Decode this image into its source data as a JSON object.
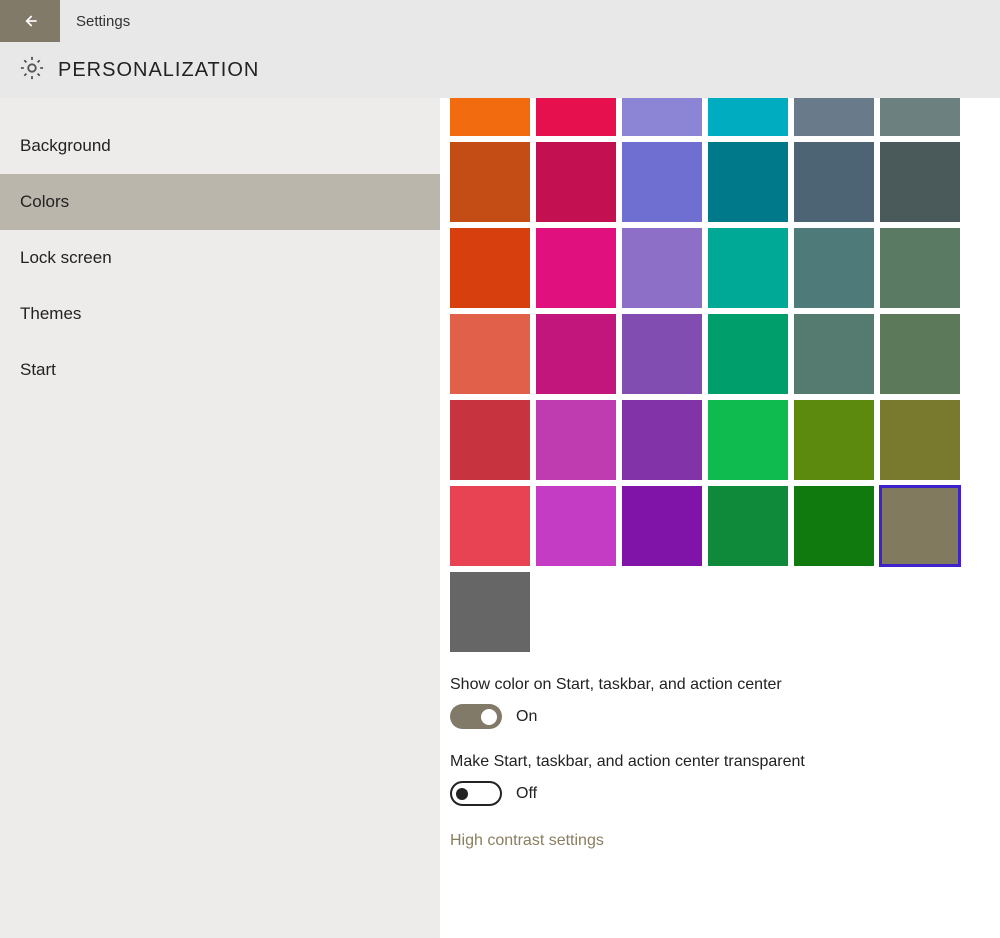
{
  "titlebar": {
    "title": "Settings"
  },
  "header": {
    "title": "PERSONALIZATION"
  },
  "sidebar": {
    "items": [
      {
        "label": "Background",
        "selected": false
      },
      {
        "label": "Colors",
        "selected": true
      },
      {
        "label": "Lock screen",
        "selected": false
      },
      {
        "label": "Themes",
        "selected": false
      },
      {
        "label": "Start",
        "selected": false
      }
    ]
  },
  "colors": {
    "row0": [
      "#f26b0f",
      "#e7104f",
      "#8c85d6",
      "#00acbf",
      "#697a8a",
      "#6d8080"
    ],
    "rows": [
      [
        "#c44c15",
        "#c31051",
        "#6f6fd1",
        "#007a8a",
        "#4d6475",
        "#4a5a5a"
      ],
      [
        "#d83f0f",
        "#e0107e",
        "#8e6fc7",
        "#00a896",
        "#4f7a7a",
        "#5a7a63"
      ],
      [
        "#e0604a",
        "#c2167d",
        "#814db0",
        "#009e6b",
        "#557a6f",
        "#5c7a5a"
      ],
      [
        "#c7333e",
        "#bf3cb0",
        "#8233a8",
        "#0fba4f",
        "#5c8a0f",
        "#7a7a2e"
      ],
      [
        "#e84352",
        "#c43cc4",
        "#8014a8",
        "#0f8a3b",
        "#117a0f",
        "#827a5e"
      ]
    ],
    "extra": [
      "#666666"
    ],
    "selected_index": [
      5,
      5
    ]
  },
  "toggles": {
    "show_color": {
      "label": "Show color on Start, taskbar, and action center",
      "state_label": "On",
      "on": true
    },
    "transparent": {
      "label": "Make Start, taskbar, and action center transparent",
      "state_label": "Off",
      "on": false
    }
  },
  "link": {
    "high_contrast": "High contrast settings"
  }
}
